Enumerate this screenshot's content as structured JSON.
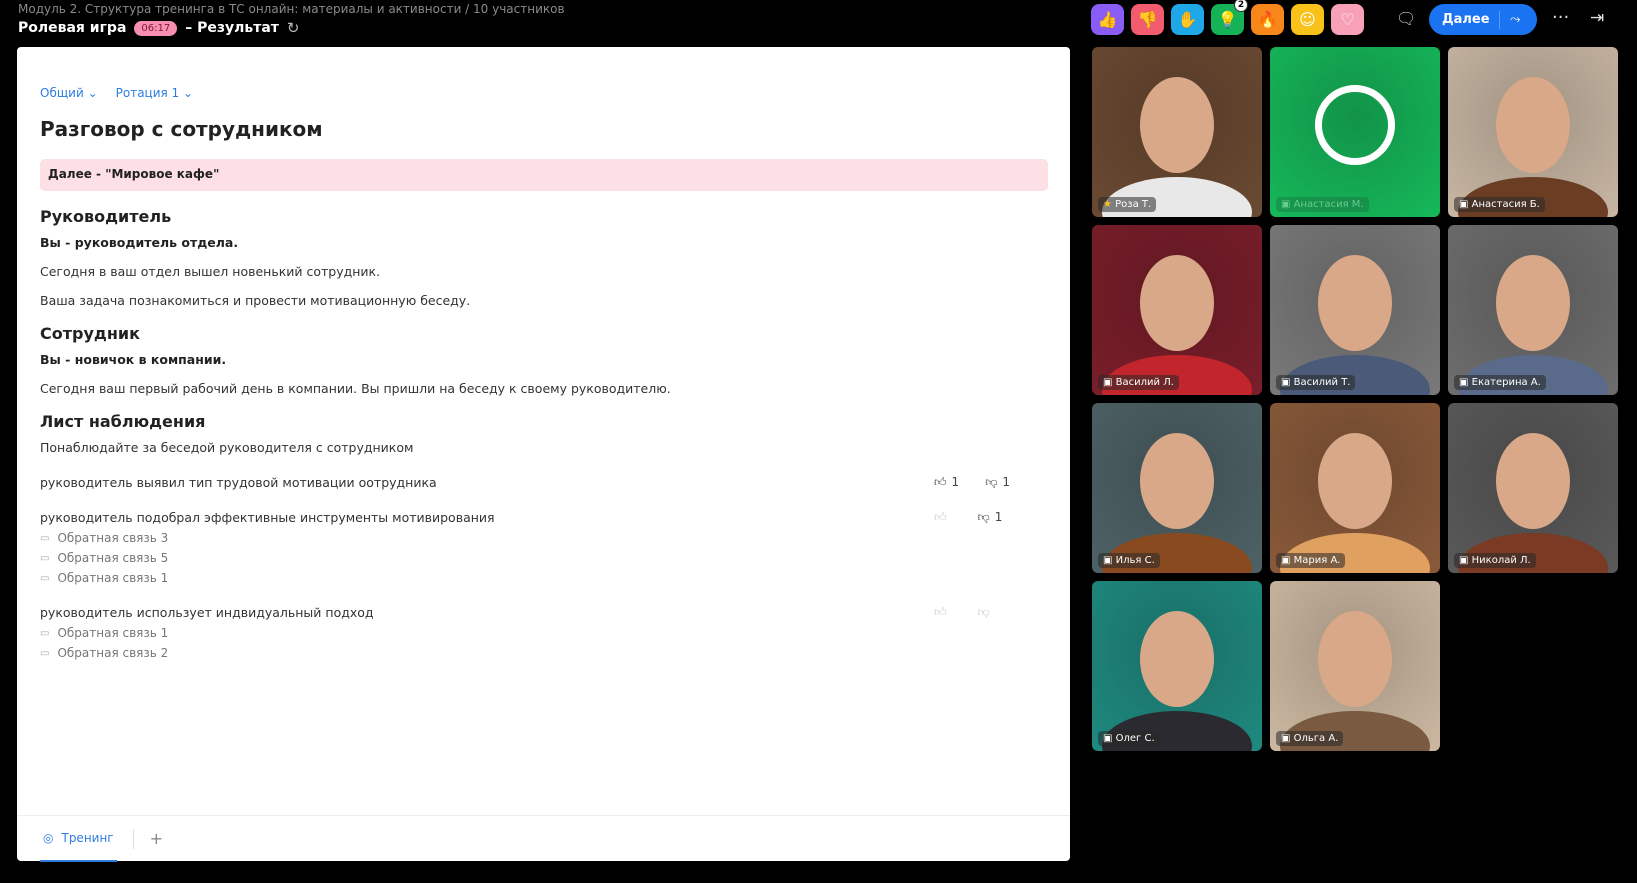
{
  "header": {
    "breadcrumb": "Модуль 2. Структура тренинга в ТС онлайн: материалы и активности / 10 участников",
    "activity": "Ролевая игра",
    "timer": "06:17",
    "result": "– Результат"
  },
  "reactions": [
    {
      "icon": "thumbs-up",
      "glyph": "👍",
      "color": "#8a5cf6"
    },
    {
      "icon": "thumbs-down",
      "glyph": "👎",
      "color": "#f25c6e"
    },
    {
      "icon": "hand",
      "glyph": "✋",
      "color": "#1fa8e8"
    },
    {
      "icon": "lightbulb",
      "glyph": "💡",
      "color": "#16b257",
      "badge": "2"
    },
    {
      "icon": "fire",
      "glyph": "🔥",
      "color": "#f7871a"
    },
    {
      "icon": "smile",
      "glyph": "☺",
      "color": "#f8c21a"
    },
    {
      "icon": "heart",
      "glyph": "♡",
      "color": "#f7a0b8"
    }
  ],
  "controls": {
    "next": "Далее"
  },
  "panel": {
    "tab1": "Общий",
    "tab2": "Ротация 1",
    "title": "Разговор с сотрудником",
    "banner": "Далее - \"Мировое кафе\"",
    "sections": [
      {
        "heading": "Руководитель",
        "lines": [
          "Вы - руководитель отдела.",
          "Сегодня в ваш отдел вышел новенький сотрудник.",
          "Ваша задача познакомиться и провести мотивационную беседу."
        ]
      },
      {
        "heading": "Сотрудник",
        "lines": [
          "Вы - новичок в компании.",
          "Сегодня ваш первый рабочий день в компании. Вы пришли на беседу к своему руководителю."
        ]
      }
    ],
    "observation": {
      "heading": "Лист наблюдения",
      "intro": "Понаблюдайте за  беседой руководителя с сотрудником",
      "criteria": [
        {
          "text": "руководитель выявил тип трудовой мотивации оотрудника",
          "up": "1",
          "down": "1",
          "feedback": []
        },
        {
          "text": "руководитель подобрал эффективные инструменты мотивирования",
          "up": "",
          "down": "1",
          "feedback": [
            "Обратная связь 3",
            "Обратная связь 5",
            "Обратная связь 1"
          ]
        },
        {
          "text": "руководитель использует индвидуальный подход",
          "up": "",
          "down": "",
          "feedback": [
            "Обратная связь 1",
            "Обратная связь 2"
          ]
        }
      ]
    },
    "footer_tab": "Тренинг"
  },
  "participants": [
    {
      "name": "Роза Т.",
      "host": true,
      "bg": "#6b4a32",
      "shirt": "#e8e8e8"
    },
    {
      "name": "Анастасия М.",
      "bulb": true,
      "bg": "#16b85a"
    },
    {
      "name": "Анастасия Б.",
      "bg": "#c9b7a4",
      "shirt": "#6b3e24"
    },
    {
      "name": "Василий Л.",
      "bg": "#7a1e2a",
      "shirt": "#c2262c"
    },
    {
      "name": "Василий Т.",
      "bg": "#7a7a7a",
      "shirt": "#4a5a78"
    },
    {
      "name": "Екатерина А.",
      "bg": "#6e6e6e",
      "shirt": "#5a6a8a"
    },
    {
      "name": "Илья С.",
      "bg": "#4e6266",
      "shirt": "#8a4a20"
    },
    {
      "name": "Мария А.",
      "bg": "#8a5a3a",
      "shirt": "#e0a060"
    },
    {
      "name": "Николай Л.",
      "bg": "#5a5a5a",
      "shirt": "#7a3a24"
    },
    {
      "name": "Олег С.",
      "bg": "#1f8a80",
      "shirt": "#2a2a30"
    },
    {
      "name": "Ольга А.",
      "bg": "#cdb9a2",
      "shirt": "#7a5a40"
    }
  ]
}
